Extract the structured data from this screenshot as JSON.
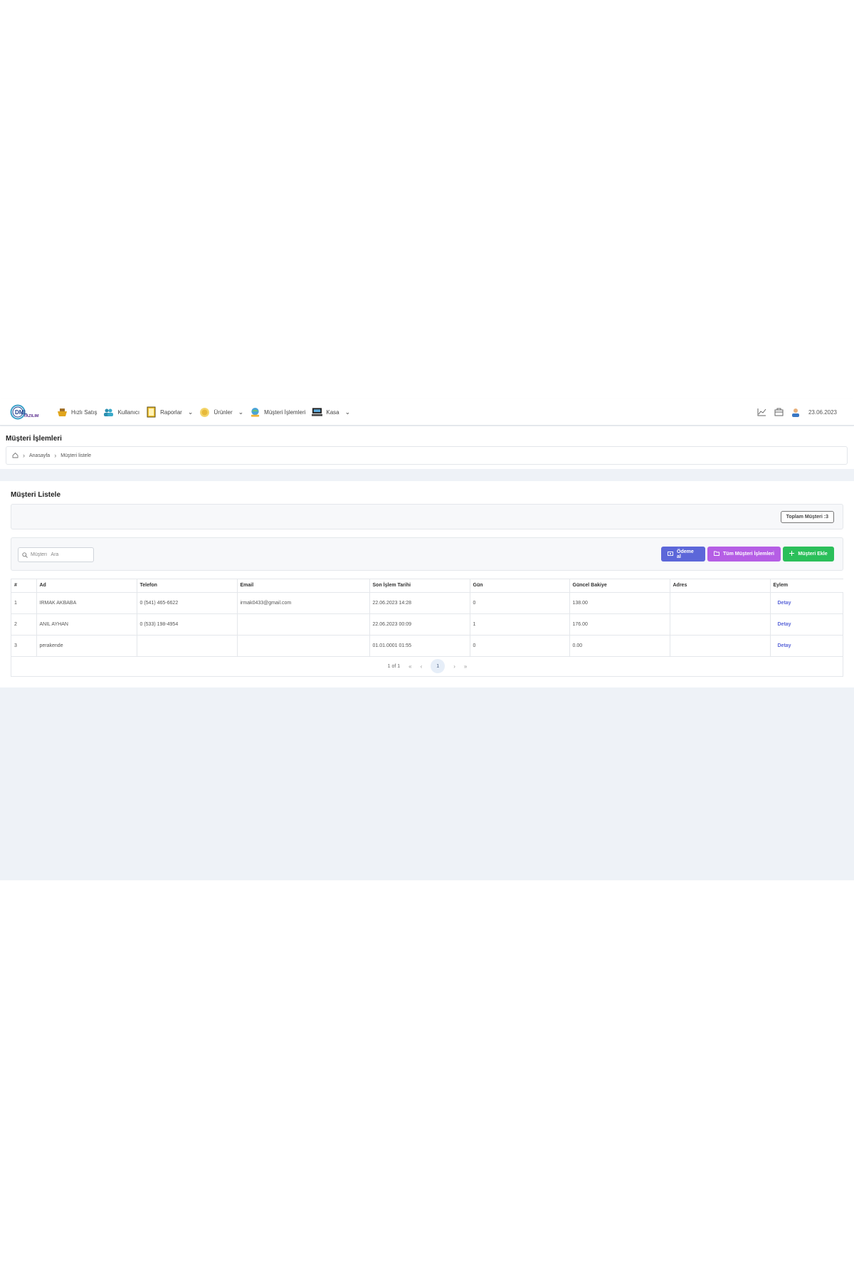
{
  "brand": {
    "logo_text": "DML",
    "logo_sub": "YAZILIM"
  },
  "nav": {
    "items": [
      {
        "label": "Hızlı Satış",
        "icon": "shopping-basket-icon",
        "dropdown": false
      },
      {
        "label": "Kullanıcı",
        "icon": "users-icon",
        "dropdown": false
      },
      {
        "label": "Raporlar",
        "icon": "report-book-icon",
        "dropdown": true
      },
      {
        "label": "Ürünler",
        "icon": "coin-products-icon",
        "dropdown": true
      },
      {
        "label": "Müşteri İşlemleri",
        "icon": "customer-globe-icon",
        "dropdown": false
      },
      {
        "label": "Kasa",
        "icon": "cash-register-icon",
        "dropdown": true
      }
    ],
    "right": {
      "date": "23.06.2023"
    }
  },
  "page": {
    "title": "Müşteri İşlemleri",
    "breadcrumb": [
      "Anasayfa",
      "Müşteri listele"
    ]
  },
  "card": {
    "title": "Müşteri Listele",
    "total_label": "Toplam Müşteri :3",
    "search_placeholder": "Müşteri   Ara",
    "buttons": {
      "payment": "Ödeme al",
      "all_transactions": "Tüm Müşteri İşlemleri",
      "add_customer": "Müşteri Ekle"
    }
  },
  "table": {
    "columns": [
      "#",
      "Ad",
      "Telefon",
      "Email",
      "Son İşlem Tarihi",
      "Gün",
      "Güncel Bakiye",
      "Adres",
      "Eylem"
    ],
    "rows": [
      {
        "no": "1",
        "name": "IRMAK AKBABA",
        "phone": "0 (541) 465-6622",
        "email": "irmak0433@gmail.com",
        "last_date": "22.06.2023 14:28",
        "days": "0",
        "balance": "138.00",
        "address": "",
        "action": "Detay"
      },
      {
        "no": "2",
        "name": "ANIL AYHAN",
        "phone": "0 (533) 198-4954",
        "email": "",
        "last_date": "22.06.2023 00:09",
        "days": "1",
        "balance": "176.00",
        "address": "",
        "action": "Detay"
      },
      {
        "no": "3",
        "name": "perakende",
        "phone": "",
        "email": "",
        "last_date": "01.01.0001 01:55",
        "days": "0",
        "balance": "0.00",
        "address": "",
        "action": "Detay"
      }
    ],
    "pagination": {
      "summary": "1 of 1",
      "current": "1"
    }
  },
  "colors": {
    "primary": "#5c67d9",
    "purple": "#b55ee5",
    "green": "#2bbf5a",
    "background": "#eef2f7"
  }
}
